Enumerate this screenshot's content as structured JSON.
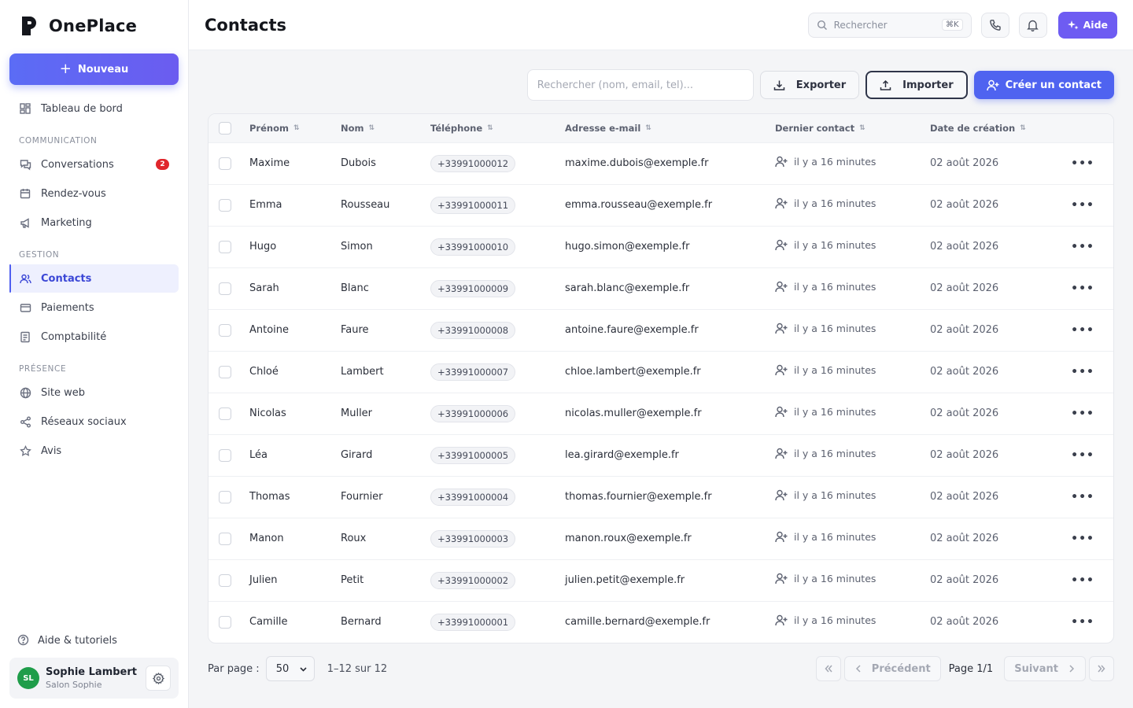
{
  "brand": {
    "name": "OnePlace"
  },
  "sidebar": {
    "new_label": "Nouveau",
    "dashboard": "Tableau de bord",
    "sections": {
      "communication": "COMMUNICATION",
      "gestion": "GESTION",
      "presence": "PRÉSENCE"
    },
    "items": {
      "conversations": "Conversations",
      "conversations_badge": "2",
      "rendezvous": "Rendez-vous",
      "marketing": "Marketing",
      "contacts": "Contacts",
      "paiements": "Paiements",
      "comptabilite": "Comptabilité",
      "siteweb": "Site web",
      "reseaux": "Réseaux sociaux",
      "avis": "Avis"
    },
    "help": "Aide & tutoriels",
    "user": {
      "initials": "SL",
      "name": "Sophie Lambert",
      "company": "Salon Sophie"
    }
  },
  "header": {
    "title": "Contacts",
    "search_placeholder": "Rechercher",
    "shortcut": "⌘K",
    "help_label": "Aide"
  },
  "toolbar": {
    "search_placeholder": "Rechercher (nom, email, tel)...",
    "export": "Exporter",
    "import": "Importer",
    "create": "Créer un contact"
  },
  "table": {
    "columns": [
      "Prénom",
      "Nom",
      "Téléphone",
      "Adresse e-mail",
      "Dernier contact",
      "Date de création"
    ],
    "rows": [
      {
        "first": "Maxime",
        "last": "Dubois",
        "phone": "+33991000012",
        "email": "maxime.dubois@exemple.fr",
        "last_contact": "il y a 16 minutes",
        "created": "02 août 2026"
      },
      {
        "first": "Emma",
        "last": "Rousseau",
        "phone": "+33991000011",
        "email": "emma.rousseau@exemple.fr",
        "last_contact": "il y a 16 minutes",
        "created": "02 août 2026"
      },
      {
        "first": "Hugo",
        "last": "Simon",
        "phone": "+33991000010",
        "email": "hugo.simon@exemple.fr",
        "last_contact": "il y a 16 minutes",
        "created": "02 août 2026"
      },
      {
        "first": "Sarah",
        "last": "Blanc",
        "phone": "+33991000009",
        "email": "sarah.blanc@exemple.fr",
        "last_contact": "il y a 16 minutes",
        "created": "02 août 2026"
      },
      {
        "first": "Antoine",
        "last": "Faure",
        "phone": "+33991000008",
        "email": "antoine.faure@exemple.fr",
        "last_contact": "il y a 16 minutes",
        "created": "02 août 2026"
      },
      {
        "first": "Chloé",
        "last": "Lambert",
        "phone": "+33991000007",
        "email": "chloe.lambert@exemple.fr",
        "last_contact": "il y a 16 minutes",
        "created": "02 août 2026"
      },
      {
        "first": "Nicolas",
        "last": "Muller",
        "phone": "+33991000006",
        "email": "nicolas.muller@exemple.fr",
        "last_contact": "il y a 16 minutes",
        "created": "02 août 2026"
      },
      {
        "first": "Léa",
        "last": "Girard",
        "phone": "+33991000005",
        "email": "lea.girard@exemple.fr",
        "last_contact": "il y a 16 minutes",
        "created": "02 août 2026"
      },
      {
        "first": "Thomas",
        "last": "Fournier",
        "phone": "+33991000004",
        "email": "thomas.fournier@exemple.fr",
        "last_contact": "il y a 16 minutes",
        "created": "02 août 2026"
      },
      {
        "first": "Manon",
        "last": "Roux",
        "phone": "+33991000003",
        "email": "manon.roux@exemple.fr",
        "last_contact": "il y a 16 minutes",
        "created": "02 août 2026"
      },
      {
        "first": "Julien",
        "last": "Petit",
        "phone": "+33991000002",
        "email": "julien.petit@exemple.fr",
        "last_contact": "il y a 16 minutes",
        "created": "02 août 2026"
      },
      {
        "first": "Camille",
        "last": "Bernard",
        "phone": "+33991000001",
        "email": "camille.bernard@exemple.fr",
        "last_contact": "il y a 16 minutes",
        "created": "02 août 2026"
      }
    ]
  },
  "pagination": {
    "per_page_label": "Par page :",
    "per_page": "50",
    "range": "1–12 sur 12",
    "prev": "Précédent",
    "page": "Page 1/1",
    "next": "Suivant"
  },
  "colors": {
    "accent": "#4f63f0",
    "help": "#6e5cf2",
    "badge": "#e0262c",
    "avatar": "#1f9d4a"
  }
}
